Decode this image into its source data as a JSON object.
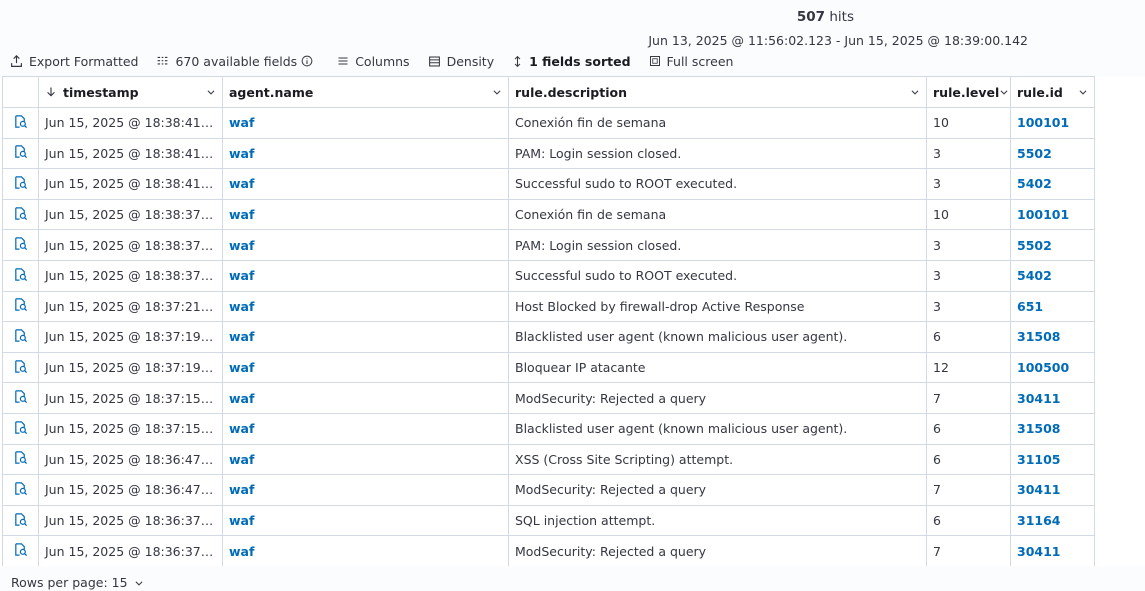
{
  "summary": {
    "hits_count": "507",
    "hits_label": "hits",
    "time_range": "Jun 13, 2025 @ 11:56:02.123 - Jun 15, 2025 @ 18:39:00.142"
  },
  "toolbar": {
    "export_label": "Export Formatted",
    "fields_label": "670 available fields",
    "columns_label": "Columns",
    "density_label": "Density",
    "sorted_label": "1 fields sorted",
    "fullscreen_label": "Full screen"
  },
  "columns": [
    {
      "label": "timestamp",
      "sorted": "descending"
    },
    {
      "label": "agent.name"
    },
    {
      "label": "rule.description"
    },
    {
      "label": "rule.level"
    },
    {
      "label": "rule.id"
    }
  ],
  "rows": [
    {
      "timestamp": "Jun 15, 2025 @ 18:38:41.9…",
      "agent": "waf",
      "description": "Conexión fin de semana",
      "level": "10",
      "id": "100101"
    },
    {
      "timestamp": "Jun 15, 2025 @ 18:38:41.9…",
      "agent": "waf",
      "description": "PAM: Login session closed.",
      "level": "3",
      "id": "5502"
    },
    {
      "timestamp": "Jun 15, 2025 @ 18:38:41.8…",
      "agent": "waf",
      "description": "Successful sudo to ROOT executed.",
      "level": "3",
      "id": "5402"
    },
    {
      "timestamp": "Jun 15, 2025 @ 18:38:37.9…",
      "agent": "waf",
      "description": "Conexión fin de semana",
      "level": "10",
      "id": "100101"
    },
    {
      "timestamp": "Jun 15, 2025 @ 18:38:37.9…",
      "agent": "waf",
      "description": "PAM: Login session closed.",
      "level": "3",
      "id": "5502"
    },
    {
      "timestamp": "Jun 15, 2025 @ 18:38:37.8…",
      "agent": "waf",
      "description": "Successful sudo to ROOT executed.",
      "level": "3",
      "id": "5402"
    },
    {
      "timestamp": "Jun 15, 2025 @ 18:37:21.8…",
      "agent": "waf",
      "description": "Host Blocked by firewall-drop Active Response",
      "level": "3",
      "id": "651"
    },
    {
      "timestamp": "Jun 15, 2025 @ 18:37:19.8…",
      "agent": "waf",
      "description": "Blacklisted user agent (known malicious user agent).",
      "level": "6",
      "id": "31508"
    },
    {
      "timestamp": "Jun 15, 2025 @ 18:37:19.8…",
      "agent": "waf",
      "description": "Bloquear IP atacante",
      "level": "12",
      "id": "100500"
    },
    {
      "timestamp": "Jun 15, 2025 @ 18:37:15.8…",
      "agent": "waf",
      "description": "ModSecurity: Rejected a query",
      "level": "7",
      "id": "30411"
    },
    {
      "timestamp": "Jun 15, 2025 @ 18:37:15.8…",
      "agent": "waf",
      "description": "Blacklisted user agent (known malicious user agent).",
      "level": "6",
      "id": "31508"
    },
    {
      "timestamp": "Jun 15, 2025 @ 18:36:47.8…",
      "agent": "waf",
      "description": "XSS (Cross Site Scripting) attempt.",
      "level": "6",
      "id": "31105"
    },
    {
      "timestamp": "Jun 15, 2025 @ 18:36:47.8…",
      "agent": "waf",
      "description": "ModSecurity: Rejected a query",
      "level": "7",
      "id": "30411"
    },
    {
      "timestamp": "Jun 15, 2025 @ 18:36:37.8…",
      "agent": "waf",
      "description": "SQL injection attempt.",
      "level": "6",
      "id": "31164"
    },
    {
      "timestamp": "Jun 15, 2025 @ 18:36:37.7…",
      "agent": "waf",
      "description": "ModSecurity: Rejected a query",
      "level": "7",
      "id": "30411"
    }
  ],
  "pagination": {
    "rows_per_page_label": "Rows per page: 15"
  },
  "colors": {
    "link": "#006bb8",
    "border": "#d3dae6",
    "text": "#343741",
    "inspect_icon": "#006bb8"
  },
  "icons": {
    "row_control": "inspect-document-icon",
    "column_menu": "chevron-down-icon",
    "sort": "arrow-down-icon"
  }
}
